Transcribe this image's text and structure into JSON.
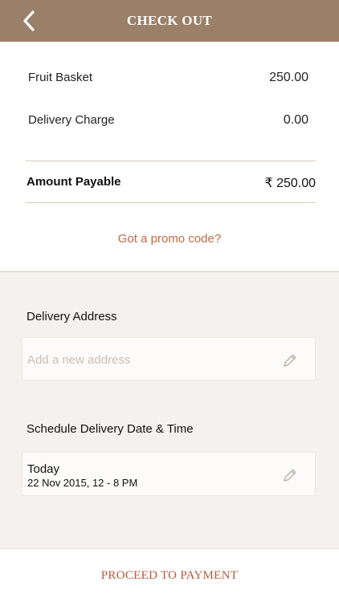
{
  "header": {
    "title": "CHECK OUT",
    "back_icon": "chevron-left-icon"
  },
  "summary": {
    "items": [
      {
        "label": "Fruit Basket",
        "value": "250.00"
      },
      {
        "label": "Delivery Charge",
        "value": "0.00"
      }
    ],
    "payable_label": "Amount Payable",
    "payable_value": "₹ 250.00",
    "promo_link": "Got a promo code?"
  },
  "delivery": {
    "address_label": "Delivery Address",
    "address_placeholder": "Add a new address",
    "schedule_label": "Schedule Delivery Date & Time",
    "schedule_day": "Today",
    "schedule_date": "22 Nov 2015, 12 - 8 PM",
    "edit_icon": "pencil-icon"
  },
  "footer": {
    "proceed_label": "PROCEED TO PAYMENT"
  },
  "colors": {
    "header_bg": "#9a7f69",
    "accent": "#c06a45",
    "page_bg": "#f5f1ee"
  }
}
